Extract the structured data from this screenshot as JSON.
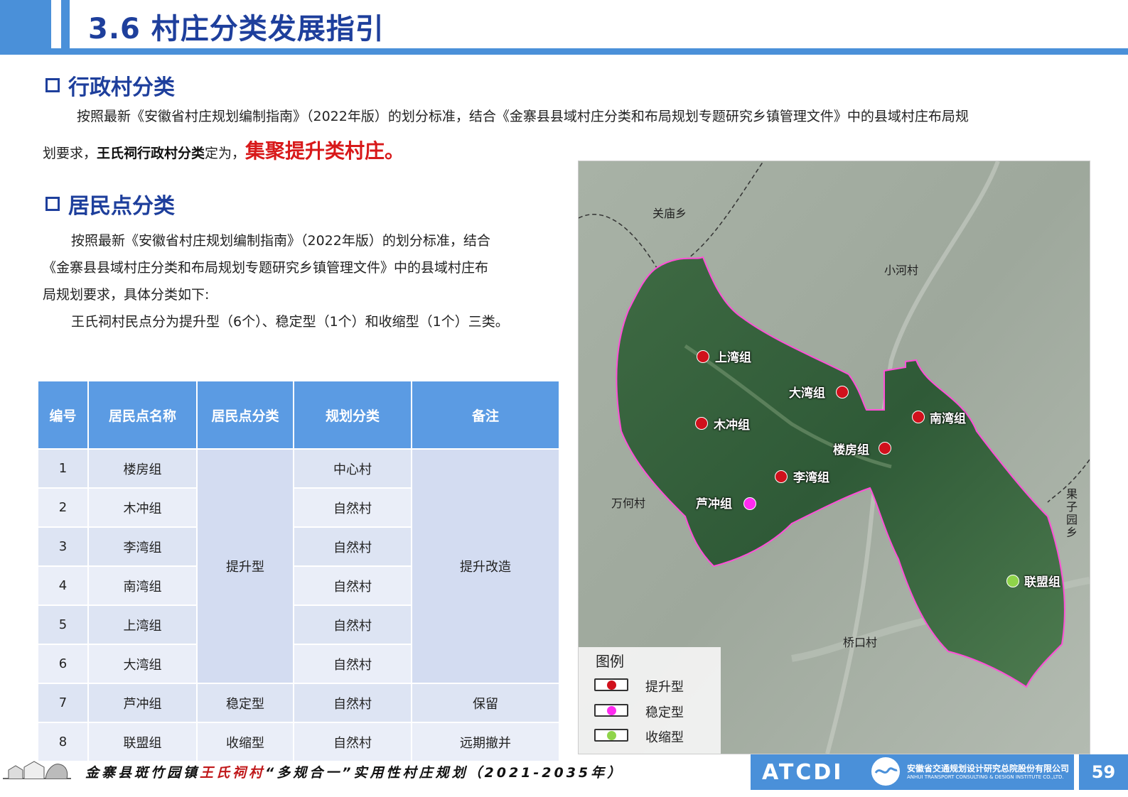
{
  "header": {
    "title": "3.6 村庄分类发展指引"
  },
  "section1": {
    "heading": "行政村分类",
    "para_a": "按照最新《安徽省村庄规划编制指南》（2022年版）的划分标准，结合《金寨县县域村庄分类和布局规划专题研究乡镇管理文件》中的县域村庄布局规",
    "para_b_pre": "划要求，",
    "para_b_bold": "王氏祠行政村分类",
    "para_b_mid": "定为，",
    "para_b_highlight": "集聚提升类村庄。"
  },
  "section2": {
    "heading": "居民点分类",
    "line1": "按照最新《安徽省村庄规划编制指南》（2022年版）的划分标准，结合",
    "line2": "《金寨县县域村庄分类和布局规划专题研究乡镇管理文件》中的县域村庄布",
    "line3": "局规划要求，具体分类如下:",
    "line4": "王氏祠村民点分为提升型（6个）、稳定型（1个）和收缩型（1个）三类。"
  },
  "table": {
    "headers": [
      "编号",
      "居民点名称",
      "居民点分类",
      "规划分类",
      "备注"
    ],
    "rows": [
      {
        "no": "1",
        "name": "楼房组",
        "plan": "中心村"
      },
      {
        "no": "2",
        "name": "木冲组",
        "plan": "自然村"
      },
      {
        "no": "3",
        "name": "李湾组",
        "plan": "自然村"
      },
      {
        "no": "4",
        "name": "南湾组",
        "plan": "自然村"
      },
      {
        "no": "5",
        "name": "上湾组",
        "plan": "自然村"
      },
      {
        "no": "6",
        "name": "大湾组",
        "plan": "自然村"
      },
      {
        "no": "7",
        "name": "芦冲组",
        "type": "稳定型",
        "plan": "自然村",
        "note": "保留"
      },
      {
        "no": "8",
        "name": "联盟组",
        "type": "收缩型",
        "plan": "自然村",
        "note": "远期撤并"
      }
    ],
    "merged_type": "提升型",
    "merged_note": "提升改造"
  },
  "map": {
    "places": {
      "guanmiao": "关庙乡",
      "xiaohe": "小河村",
      "wanhe": "万何村",
      "qiaokou": "桥口村",
      "guoziyuan": "果子园乡"
    },
    "points": {
      "shangwan": "上湾组",
      "dawan": "大湾组",
      "muchong": "木冲组",
      "nanwan": "南湾组",
      "loufang": "楼房组",
      "liwan": "李湾组",
      "luchong": "芦冲组",
      "lianmeng": "联盟组"
    },
    "legend": {
      "title": "图例",
      "items": [
        {
          "label": "提升型",
          "color": "#d0111c"
        },
        {
          "label": "稳定型",
          "color": "#ff2bf0"
        },
        {
          "label": "收缩型",
          "color": "#8fd44a"
        }
      ]
    },
    "colors": {
      "boundary": "#ff4fd8",
      "upgrade": "#d0111c",
      "stable": "#ff2bf0",
      "shrink": "#8fd44a"
    }
  },
  "footer": {
    "text_pre": "金寨县斑竹园镇",
    "text_red": "王氏祠村",
    "text_post": "“多规合一”实用性村庄规划（2021-2035年）",
    "logo": "ATCDI",
    "company_cn": "安徽省交通规划设计研究总院股份有限公司",
    "company_en": "ANHUI TRANSPORT CONSULTING & DESIGN INSTITUTE CO.,LTD.",
    "page": "59"
  },
  "theme": {
    "accent": "#4a90d9",
    "heading": "#1e3f9c",
    "highlight": "#d8191a"
  }
}
